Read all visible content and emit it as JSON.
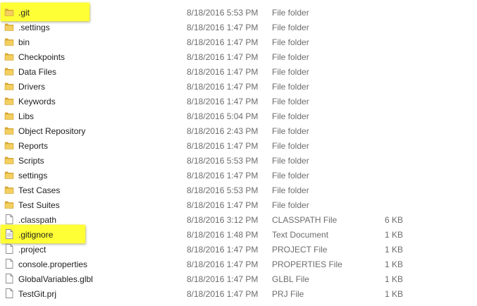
{
  "colors": {
    "highlight": "#ffff35",
    "folder": "#e9c14d",
    "muted_text": "#6d6d6d"
  },
  "files": [
    {
      "name": ".git",
      "date": "8/18/2016 5:53 PM",
      "type": "File folder",
      "size": "",
      "icon": "folder-icon",
      "highlighted": true
    },
    {
      "name": ".settings",
      "date": "8/18/2016 1:47 PM",
      "type": "File folder",
      "size": "",
      "icon": "folder-icon",
      "highlighted": false
    },
    {
      "name": "bin",
      "date": "8/18/2016 1:47 PM",
      "type": "File folder",
      "size": "",
      "icon": "folder-icon",
      "highlighted": false
    },
    {
      "name": "Checkpoints",
      "date": "8/18/2016 1:47 PM",
      "type": "File folder",
      "size": "",
      "icon": "folder-icon",
      "highlighted": false
    },
    {
      "name": "Data Files",
      "date": "8/18/2016 1:47 PM",
      "type": "File folder",
      "size": "",
      "icon": "folder-icon",
      "highlighted": false
    },
    {
      "name": "Drivers",
      "date": "8/18/2016 1:47 PM",
      "type": "File folder",
      "size": "",
      "icon": "folder-icon",
      "highlighted": false
    },
    {
      "name": "Keywords",
      "date": "8/18/2016 1:47 PM",
      "type": "File folder",
      "size": "",
      "icon": "folder-icon",
      "highlighted": false
    },
    {
      "name": "Libs",
      "date": "8/18/2016 5:04 PM",
      "type": "File folder",
      "size": "",
      "icon": "folder-icon",
      "highlighted": false
    },
    {
      "name": "Object Repository",
      "date": "8/18/2016 2:43 PM",
      "type": "File folder",
      "size": "",
      "icon": "folder-icon",
      "highlighted": false
    },
    {
      "name": "Reports",
      "date": "8/18/2016 1:47 PM",
      "type": "File folder",
      "size": "",
      "icon": "folder-icon",
      "highlighted": false
    },
    {
      "name": "Scripts",
      "date": "8/18/2016 5:53 PM",
      "type": "File folder",
      "size": "",
      "icon": "folder-icon",
      "highlighted": false
    },
    {
      "name": "settings",
      "date": "8/18/2016 1:47 PM",
      "type": "File folder",
      "size": "",
      "icon": "folder-icon",
      "highlighted": false
    },
    {
      "name": "Test Cases",
      "date": "8/18/2016 5:53 PM",
      "type": "File folder",
      "size": "",
      "icon": "folder-icon",
      "highlighted": false
    },
    {
      "name": "Test Suites",
      "date": "8/18/2016 1:47 PM",
      "type": "File folder",
      "size": "",
      "icon": "folder-icon",
      "highlighted": false
    },
    {
      "name": ".classpath",
      "date": "8/18/2016 3:12 PM",
      "type": "CLASSPATH File",
      "size": "6 KB",
      "icon": "file-icon",
      "highlighted": false
    },
    {
      "name": ".gitignore",
      "date": "8/18/2016 1:48 PM",
      "type": "Text Document",
      "size": "1 KB",
      "icon": "text-document-icon",
      "highlighted": true
    },
    {
      "name": ".project",
      "date": "8/18/2016 1:47 PM",
      "type": "PROJECT File",
      "size": "1 KB",
      "icon": "file-icon",
      "highlighted": false
    },
    {
      "name": "console.properties",
      "date": "8/18/2016 1:47 PM",
      "type": "PROPERTIES File",
      "size": "1 KB",
      "icon": "file-icon",
      "highlighted": false
    },
    {
      "name": "GlobalVariables.glbl",
      "date": "8/18/2016 1:47 PM",
      "type": "GLBL File",
      "size": "1 KB",
      "icon": "file-icon",
      "highlighted": false
    },
    {
      "name": "TestGit.prj",
      "date": "8/18/2016 1:47 PM",
      "type": "PRJ File",
      "size": "1 KB",
      "icon": "file-icon",
      "highlighted": false
    }
  ]
}
